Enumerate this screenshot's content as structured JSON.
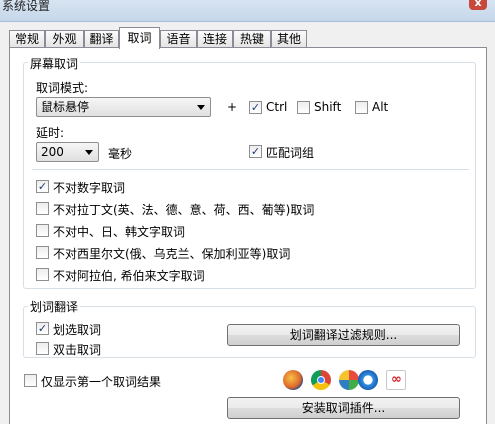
{
  "window": {
    "title": "系统设置",
    "close_glyph": "x"
  },
  "tabs": [
    "常规",
    "外观",
    "翻译",
    "取词",
    "语音",
    "连接",
    "热键",
    "其他"
  ],
  "screen_capture": {
    "title": "屏幕取词",
    "mode_label": "取词模式:",
    "mode_value": "鼠标悬停",
    "plus": "+",
    "ctrl_label": "Ctrl",
    "ctrl_checked": true,
    "shift_label": "Shift",
    "shift_checked": false,
    "alt_label": "Alt",
    "alt_checked": false,
    "delay_label": "延时:",
    "delay_value": "200",
    "delay_unit": "毫秒",
    "match_phrase_label": "匹配词组",
    "match_phrase_checked": true,
    "exclusions": [
      {
        "label": "不对数字取词",
        "checked": true
      },
      {
        "label": "不对拉丁文(英、法、德、意、荷、西、葡等)取词",
        "checked": false
      },
      {
        "label": "不对中、日、韩文字取词",
        "checked": false
      },
      {
        "label": "不对西里尔文(俄、乌克兰、保加利亚等)取词",
        "checked": false
      },
      {
        "label": "不对阿拉伯, 希伯来文字取词",
        "checked": false
      }
    ]
  },
  "select_translate": {
    "title": "划词翻译",
    "select_label": "划选取词",
    "select_checked": true,
    "dblclick_label": "双击取词",
    "dblclick_checked": false,
    "filter_button": "划词翻译过滤规则..."
  },
  "bottom": {
    "first_only_label": "仅显示第一个取词结果",
    "first_only_checked": false,
    "install_button": "安装取词插件...",
    "check_glyph": "✓",
    "browser_icons": [
      "firefox-icon",
      "chrome-icon",
      "ie-maxthon-icon",
      "acrobat-icon"
    ]
  }
}
